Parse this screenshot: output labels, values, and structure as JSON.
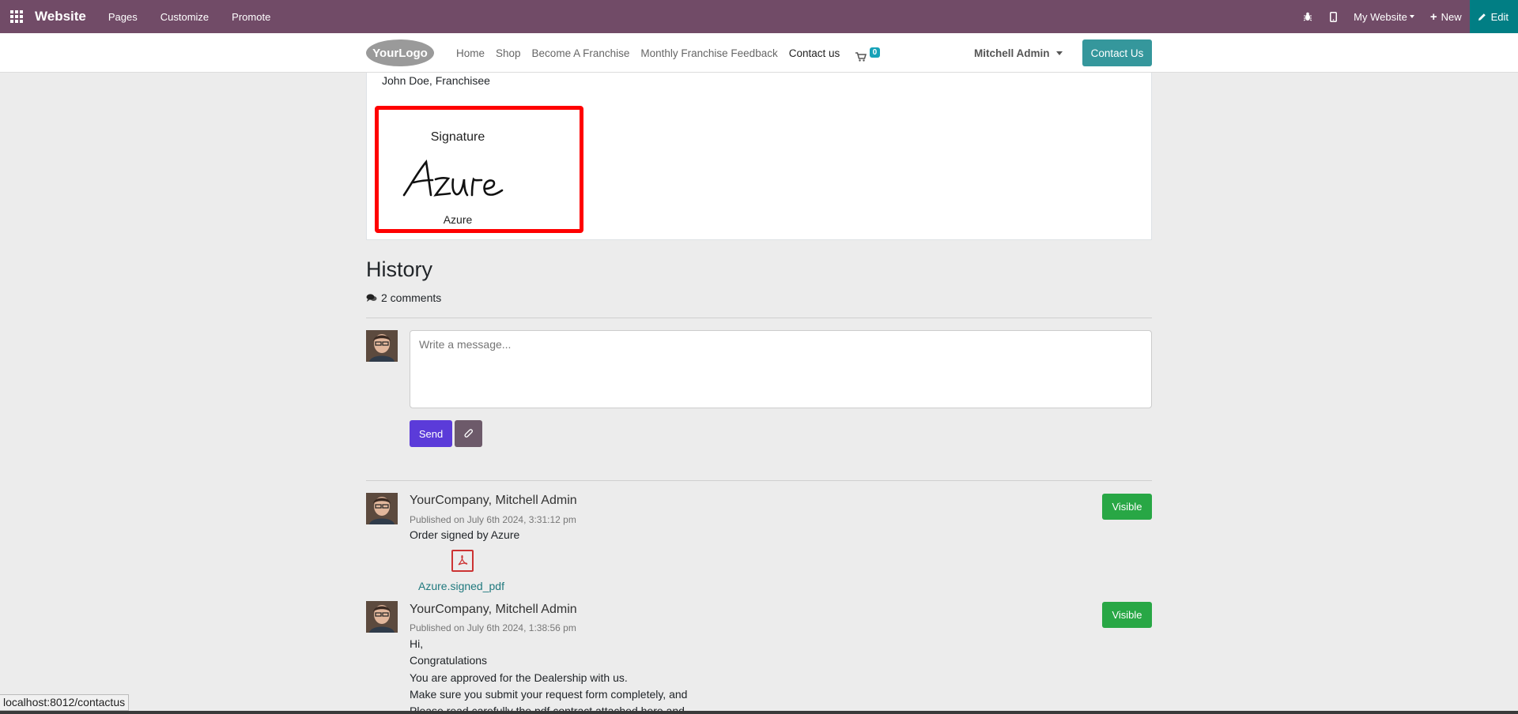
{
  "topbar": {
    "brand": "Website",
    "menu": [
      "Pages",
      "Customize",
      "Promote"
    ],
    "site_selector": "My Website",
    "new_label": "New",
    "edit_label": "Edit"
  },
  "header": {
    "logo_text": "YourLogo",
    "nav": [
      "Home",
      "Shop",
      "Become A Franchise",
      "Monthly Franchise Feedback",
      "Contact us"
    ],
    "cart_count": "0",
    "user_name": "Mitchell Admin",
    "contact_button": "Contact Us"
  },
  "signature_card": {
    "signer_line": "John Doe, Franchisee",
    "title": "Signature",
    "name": "Azure"
  },
  "history": {
    "title": "History",
    "comments_count": "2 comments",
    "composer": {
      "placeholder": "Write a message...",
      "send_label": "Send"
    },
    "messages": [
      {
        "author": "YourCompany, Mitchell Admin",
        "date": "Published on July 6th 2024, 3:31:12 pm",
        "body": [
          "Order signed by Azure"
        ],
        "attachment": "Azure.signed_pdf",
        "visibility": "Visible"
      },
      {
        "author": "YourCompany, Mitchell Admin",
        "date": "Published on July 6th 2024, 1:38:56 pm",
        "body": [
          "Hi,",
          "Congratulations",
          "You are approved for the Dealership with us.",
          "Make sure you submit your request form completely, and",
          "Please read carefully the pdf contract attached here and"
        ],
        "visibility": "Visible"
      }
    ]
  },
  "status_bar": {
    "url": "localhost:8012/contactus"
  },
  "colors": {
    "topbar": "#714b67",
    "edit": "#017e84",
    "send": "#5b3bd9",
    "visible": "#28a745",
    "highlight": "#ff0000"
  }
}
